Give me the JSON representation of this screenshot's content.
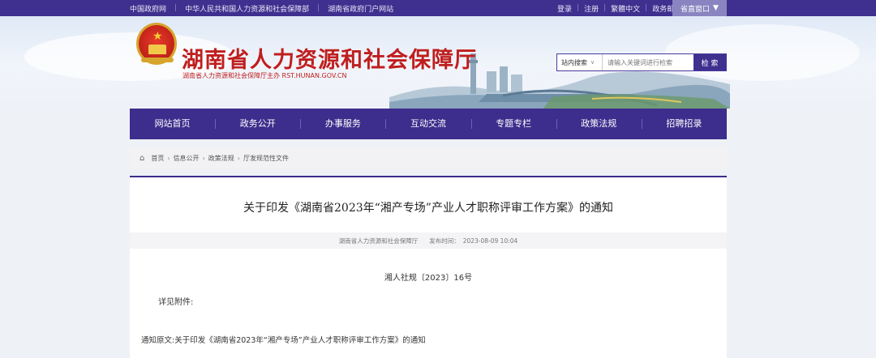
{
  "topbar": {
    "links": [
      "中国政府网",
      "中华人民共和国人力资源和社会保障部",
      "湖南省政府门户网站"
    ],
    "user_links": [
      "登录",
      "注册",
      "繁體中文",
      "政务邮箱"
    ],
    "window_label": "省直窗口",
    "window_icon": "triangle-down"
  },
  "header": {
    "title": "湖南省人力资源和社会保障厅",
    "subtitle": "湖南省人力资源和社会保障厅主办 RST.HUNAN.GOV.CN"
  },
  "search": {
    "scope_label": "站内搜索",
    "placeholder": "请输入关键词进行检索",
    "button_label": "检 索"
  },
  "nav": {
    "items": [
      "网站首页",
      "政务公开",
      "办事服务",
      "互动交流",
      "专题专栏",
      "政策法规",
      "招聘招录"
    ]
  },
  "breadcrumb": {
    "items": [
      "首页",
      "信息公开",
      "政策法规",
      "厅发规范性文件"
    ]
  },
  "article": {
    "title": "关于印发《湖南省2023年“湘产专场”产业人才职称评审工作方案》的通知",
    "source": "湖南省人力资源和社会保障厅",
    "publish_label": "发布时间：",
    "publish_time": "2023-08-09 10:04",
    "doc_number": "湘人社规〔2023〕16号",
    "see_attachment": "详见附件:",
    "original_text": "通知原文:关于印发《湖南省2023年“湘产专场”产业人才职称评审工作方案》的通知"
  },
  "colors": {
    "brand_purple": "#3d2d8c",
    "title_red": "#c01e1e"
  }
}
